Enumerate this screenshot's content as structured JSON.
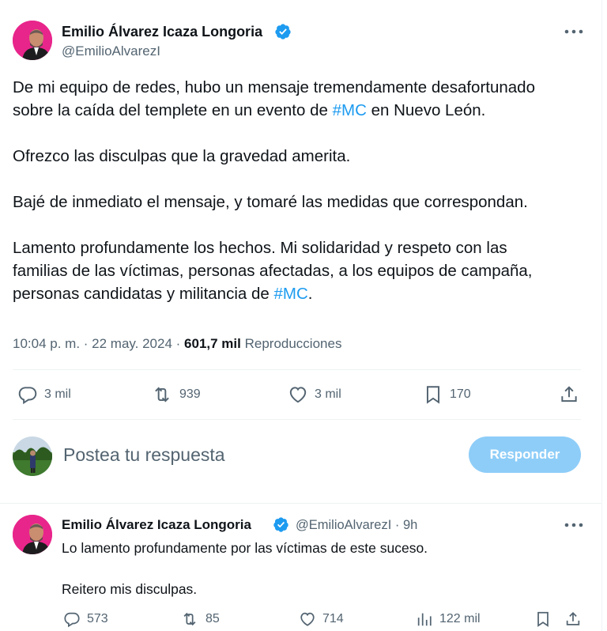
{
  "tweet": {
    "author_name": "Emilio Álvarez Icaza Longoria",
    "author_handle": "@EmilioAlvarezI",
    "p1_a": "De mi equipo de redes, hubo un mensaje tremendamente desafortunado",
    "p1_b": "sobre la caída del templete en un evento de ",
    "p1_hashtag": "#MC",
    "p1_c": " en Nuevo León.",
    "p2": "Ofrezco las disculpas que la gravedad amerita.",
    "p3": "Bajé de inmediato el mensaje, y tomaré las medidas que correspondan.",
    "p4_a": "Lamento profundamente los hechos. Mi solidaridad y respeto con las",
    "p4_b": "familias de las víctimas, personas afectadas, a los equipos de campaña,",
    "p4_c": "personas candidatas y militancia de ",
    "p4_hashtag": "#MC",
    "p4_d": ".",
    "time": "10:04 p. m.",
    "sep": " · ",
    "date": "22 may. 2024",
    "views_count": "601,7 mil",
    "views_label": " Reproducciones",
    "replies": "3 mil",
    "reposts": "939",
    "likes": "3 mil",
    "bookmarks": "170"
  },
  "composer": {
    "placeholder": "Postea tu respuesta",
    "button_label": "Responder"
  },
  "reply": {
    "author_name": "Emilio Álvarez Icaza Longoria",
    "author_handle": "@EmilioAlvarezI",
    "time": "· 9h",
    "line1": "Lo lamento profundamente por las víctimas de este suceso.",
    "line2": "Reitero mis disculpas.",
    "replies": "573",
    "reposts": "85",
    "likes": "714",
    "views": "122 mil"
  },
  "colors": {
    "accent": "#1d9bf0",
    "button_disabled": "#8ecdf8",
    "avatar_pink": "#e8258b",
    "muted": "#536471"
  }
}
